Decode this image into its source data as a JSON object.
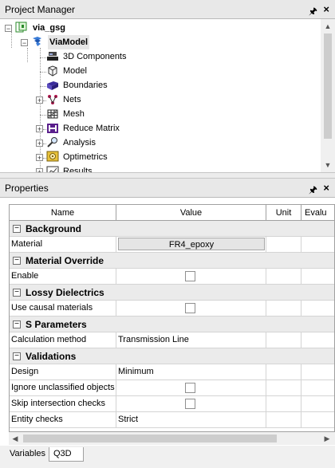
{
  "project_manager": {
    "title": "Project Manager",
    "pin": "ᴘ",
    "close": "×",
    "tree": [
      {
        "label": "via_gsg",
        "bold": true,
        "icon": "project-icon"
      },
      {
        "label": "ViaModel",
        "bold": true,
        "icon": "design-icon"
      },
      {
        "label": "3D Components",
        "icon": "components-icon"
      },
      {
        "label": "Model",
        "icon": "model-icon"
      },
      {
        "label": "Boundaries",
        "icon": "boundaries-icon"
      },
      {
        "label": "Nets",
        "icon": "nets-icon"
      },
      {
        "label": "Mesh",
        "icon": "mesh-icon"
      },
      {
        "label": "Reduce Matrix",
        "icon": "reduce-matrix-icon"
      },
      {
        "label": "Analysis",
        "icon": "analysis-icon"
      },
      {
        "label": "Optimetrics",
        "icon": "optimetrics-icon"
      },
      {
        "label": "Results",
        "icon": "results-icon"
      }
    ]
  },
  "properties": {
    "title": "Properties",
    "pin": "ᴘ",
    "close": "×",
    "columns": {
      "name": "Name",
      "value": "Value",
      "unit": "Unit",
      "eval": "Evalu"
    },
    "sections": {
      "background": {
        "label": "Background",
        "toggle": "−"
      },
      "material_override": {
        "label": "Material Override",
        "toggle": "−"
      },
      "lossy": {
        "label": "Lossy Dielectrics",
        "toggle": "−"
      },
      "s_params": {
        "label": "S Parameters",
        "toggle": "−"
      },
      "validations": {
        "label": "Validations",
        "toggle": "−"
      }
    },
    "rows": {
      "material": {
        "name": "Material",
        "value": "FR4_epoxy"
      },
      "enable": {
        "name": "Enable",
        "checked": false
      },
      "causal": {
        "name": "Use causal materials",
        "checked": false
      },
      "calc": {
        "name": "Calculation method",
        "value": "Transmission Line"
      },
      "design": {
        "name": "Design",
        "value": "Minimum"
      },
      "ignore": {
        "name": "Ignore unclassified objects",
        "checked": false
      },
      "skip": {
        "name": "Skip intersection checks",
        "checked": false
      },
      "entity": {
        "name": "Entity checks",
        "value": "Strict"
      }
    }
  },
  "tabs": {
    "variables": "Variables",
    "q3d": "Q3D",
    "active": "Q3D"
  }
}
